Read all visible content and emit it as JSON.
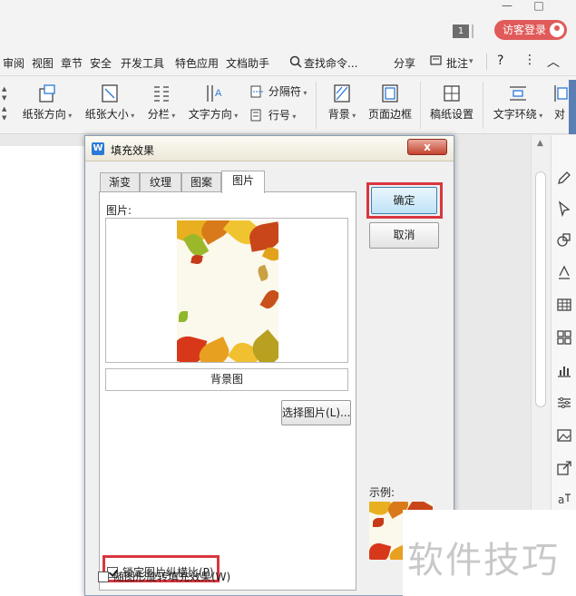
{
  "titlebar": {
    "badge": "1",
    "visitor_login": "访客登录",
    "minimize": "—",
    "maximize": "□"
  },
  "menu": {
    "items": [
      "审阅",
      "视图",
      "章节",
      "安全",
      "开发工具",
      "特色应用",
      "文档助手"
    ],
    "search": "查找命令...",
    "share": "分享",
    "comment": "批注",
    "help": "?",
    "more": "⋮",
    "collapse": "︿"
  },
  "ribbon": {
    "orientation": "纸张方向",
    "size": "纸张大小",
    "columns": "分栏",
    "text_direction": "文字方向",
    "separator": "分隔符",
    "line_number": "行号",
    "background": "背景",
    "page_border": "页面边框",
    "grid_paper": "稿纸设置",
    "text_wrap": "文字环绕",
    "align": "对"
  },
  "dialog": {
    "title": "填充效果",
    "close": "x",
    "tabs": [
      "渐变",
      "纹理",
      "图案",
      "图片"
    ],
    "active_tab": "图片",
    "picture_label": "图片:",
    "picture_name": "背景图",
    "select_picture": "选择图片(L)...",
    "lock_ratio": "锁定图片纵横比(P)",
    "lock_ratio_checked": true,
    "rotate_with_shape": "随图形旋转填充效果(W)",
    "rotate_with_shape_checked": false,
    "ok": "确定",
    "cancel": "取消",
    "example_label": "示例:"
  },
  "watermark": "软件技巧",
  "colors": {
    "highlight": "#d9363e",
    "visitor_button": "#e05a5a",
    "app_icon": "#2b79d8"
  }
}
